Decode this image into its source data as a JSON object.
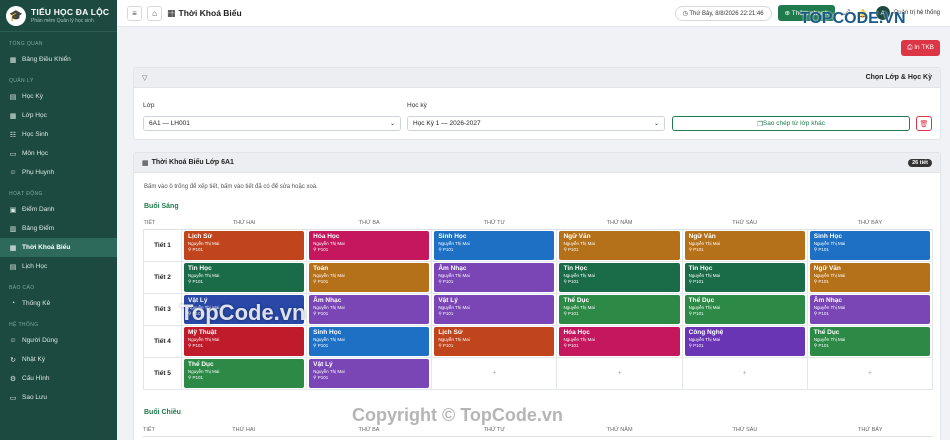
{
  "brand": {
    "name": "TIỂU HỌC ĐA LỘC",
    "subtitle": "Phần mềm Quản lý học sinh"
  },
  "sidebar": {
    "sections": [
      {
        "title": "TỔNG QUAN",
        "items": [
          {
            "label": "Bảng Điều Khiển",
            "icon": "▦"
          }
        ]
      },
      {
        "title": "QUẢN LÝ",
        "items": [
          {
            "label": "Học Kỳ",
            "icon": "▤"
          },
          {
            "label": "Lớp Học",
            "icon": "▦"
          },
          {
            "label": "Học Sinh",
            "icon": "☷"
          },
          {
            "label": "Môn Học",
            "icon": "▭"
          },
          {
            "label": "Phụ Huynh",
            "icon": "☺"
          }
        ]
      },
      {
        "title": "HOẠT ĐỘNG",
        "items": [
          {
            "label": "Điểm Danh",
            "icon": "▣"
          },
          {
            "label": "Bảng Điểm",
            "icon": "▥"
          },
          {
            "label": "Thời Khoá Biểu",
            "icon": "▦",
            "active": true
          },
          {
            "label": "Lịch Học",
            "icon": "▤"
          }
        ]
      },
      {
        "title": "BÁO CÁO",
        "items": [
          {
            "label": "Thống Kê",
            "icon": "◔"
          }
        ]
      },
      {
        "title": "HỆ THỐNG",
        "items": [
          {
            "label": "Người Dùng",
            "icon": "☺"
          },
          {
            "label": "Nhật Ký",
            "icon": "↻"
          },
          {
            "label": "Cấu Hình",
            "icon": "⚙"
          },
          {
            "label": "Sao Lưu",
            "icon": "▭"
          }
        ]
      }
    ]
  },
  "topbar": {
    "title": "Thời Khoá Biểu",
    "datetime": "Thứ Bảy, 8/8/2026 22:21:46",
    "quick": "Thêm nhanh",
    "user_initial": "A",
    "user": "Quản trị hệ thống"
  },
  "print_label": "In TKB",
  "filter": {
    "title": "Chọn Lớp & Học Kỳ",
    "class_label": "Lớp",
    "class_value": "6A1 — LH001",
    "term_label": "Học kỳ",
    "term_value": "Học Kỳ 1 — 2026-2027",
    "copy_label": "Sao chép từ lớp khác"
  },
  "timetable": {
    "title": "Thời Khoá Biểu Lớp 6A1",
    "badge": "26 tiết",
    "hint": "Bấm vào ô trống để xếp tiết, bấm vào tiết đã có để sửa hoặc xoá.",
    "columns": [
      "TIẾT",
      "THỨ HAI",
      "THỨ BA",
      "THỨ TƯ",
      "THỨ NĂM",
      "THỨ SÁU",
      "THỨ BẢY"
    ],
    "morning_label": "Buổi Sáng",
    "afternoon_label": "Buổi Chiều",
    "teacher": "Nguyễn Thị Mai",
    "room": "P101",
    "empty": "+",
    "periods": [
      {
        "label": "Tiết 1",
        "slots": [
          {
            "s": "Lịch Sử",
            "c": "#c0451d"
          },
          {
            "s": "Hóa Học",
            "c": "#c4175d"
          },
          {
            "s": "Sinh Học",
            "c": "#1e70c5"
          },
          {
            "s": "Ngữ Văn",
            "c": "#b5711a"
          },
          {
            "s": "Ngữ Văn",
            "c": "#b5711a"
          },
          {
            "s": "Sinh Học",
            "c": "#1e70c5"
          }
        ]
      },
      {
        "label": "Tiết 2",
        "slots": [
          {
            "s": "Tin Học",
            "c": "#1a6b48"
          },
          {
            "s": "Toán",
            "c": "#b5711a"
          },
          {
            "s": "Âm Nhạc",
            "c": "#7a45b5"
          },
          {
            "s": "Tin Học",
            "c": "#1a6b48"
          },
          {
            "s": "Tin Học",
            "c": "#1a6b48"
          },
          {
            "s": "Ngữ Văn",
            "c": "#b5711a"
          }
        ]
      },
      {
        "label": "Tiết 3",
        "slots": [
          {
            "s": "Vật Lý",
            "c": "#2948a8"
          },
          {
            "s": "Âm Nhạc",
            "c": "#7a45b5"
          },
          {
            "s": "Vật Lý",
            "c": "#7a45b5"
          },
          {
            "s": "Thể Dục",
            "c": "#2d8a46"
          },
          {
            "s": "Thể Dục",
            "c": "#2d8a46"
          },
          {
            "s": "Âm Nhạc",
            "c": "#7a45b5"
          }
        ]
      },
      {
        "label": "Tiết 4",
        "slots": [
          {
            "s": "Mỹ Thuật",
            "c": "#c01b2b"
          },
          {
            "s": "Sinh Học",
            "c": "#1e70c5"
          },
          {
            "s": "Lịch Sử",
            "c": "#c0451d"
          },
          {
            "s": "Hóa Học",
            "c": "#c4175d"
          },
          {
            "s": "Công Nghệ",
            "c": "#6a35b5"
          },
          {
            "s": "Thể Dục",
            "c": "#2d8a46"
          }
        ]
      },
      {
        "label": "Tiết 5",
        "slots": [
          {
            "s": "Thể Dục",
            "c": "#2d8a46"
          },
          {
            "s": "Vật Lý",
            "c": "#7a45b5"
          },
          null,
          null,
          null,
          null
        ]
      }
    ]
  },
  "watermarks": {
    "corner": "TOPCODE.VN",
    "mid": "TopCode.vn",
    "footer": "Copyright © TopCode.vn"
  }
}
